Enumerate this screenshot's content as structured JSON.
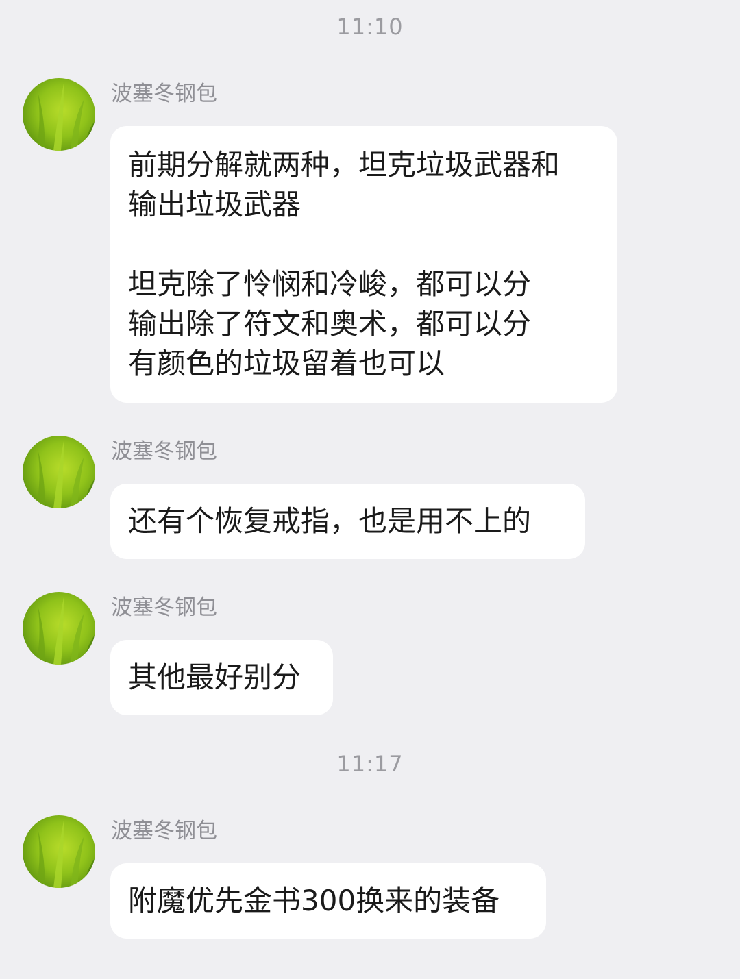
{
  "time_dividers": [
    "11:10",
    "11:17"
  ],
  "avatar_icon": "grass-avatar-icon",
  "messages": [
    {
      "sender": "波塞冬钢包",
      "paragraphs": [
        [
          "前期分解就两种，坦克垃圾武器和",
          "输出垃圾武器"
        ],
        [
          "坦克除了怜悯和冷峻，都可以分",
          "输出除了符文和奥术，都可以分",
          "有颜色的垃圾留着也可以"
        ]
      ]
    },
    {
      "sender": "波塞冬钢包",
      "paragraphs": [
        [
          "还有个恢复戒指，也是用不上的"
        ]
      ]
    },
    {
      "sender": "波塞冬钢包",
      "paragraphs": [
        [
          "其他最好别分"
        ]
      ]
    },
    {
      "sender": "波塞冬钢包",
      "paragraphs": [
        [
          "附魔优先金书300换来的装备"
        ]
      ]
    }
  ]
}
